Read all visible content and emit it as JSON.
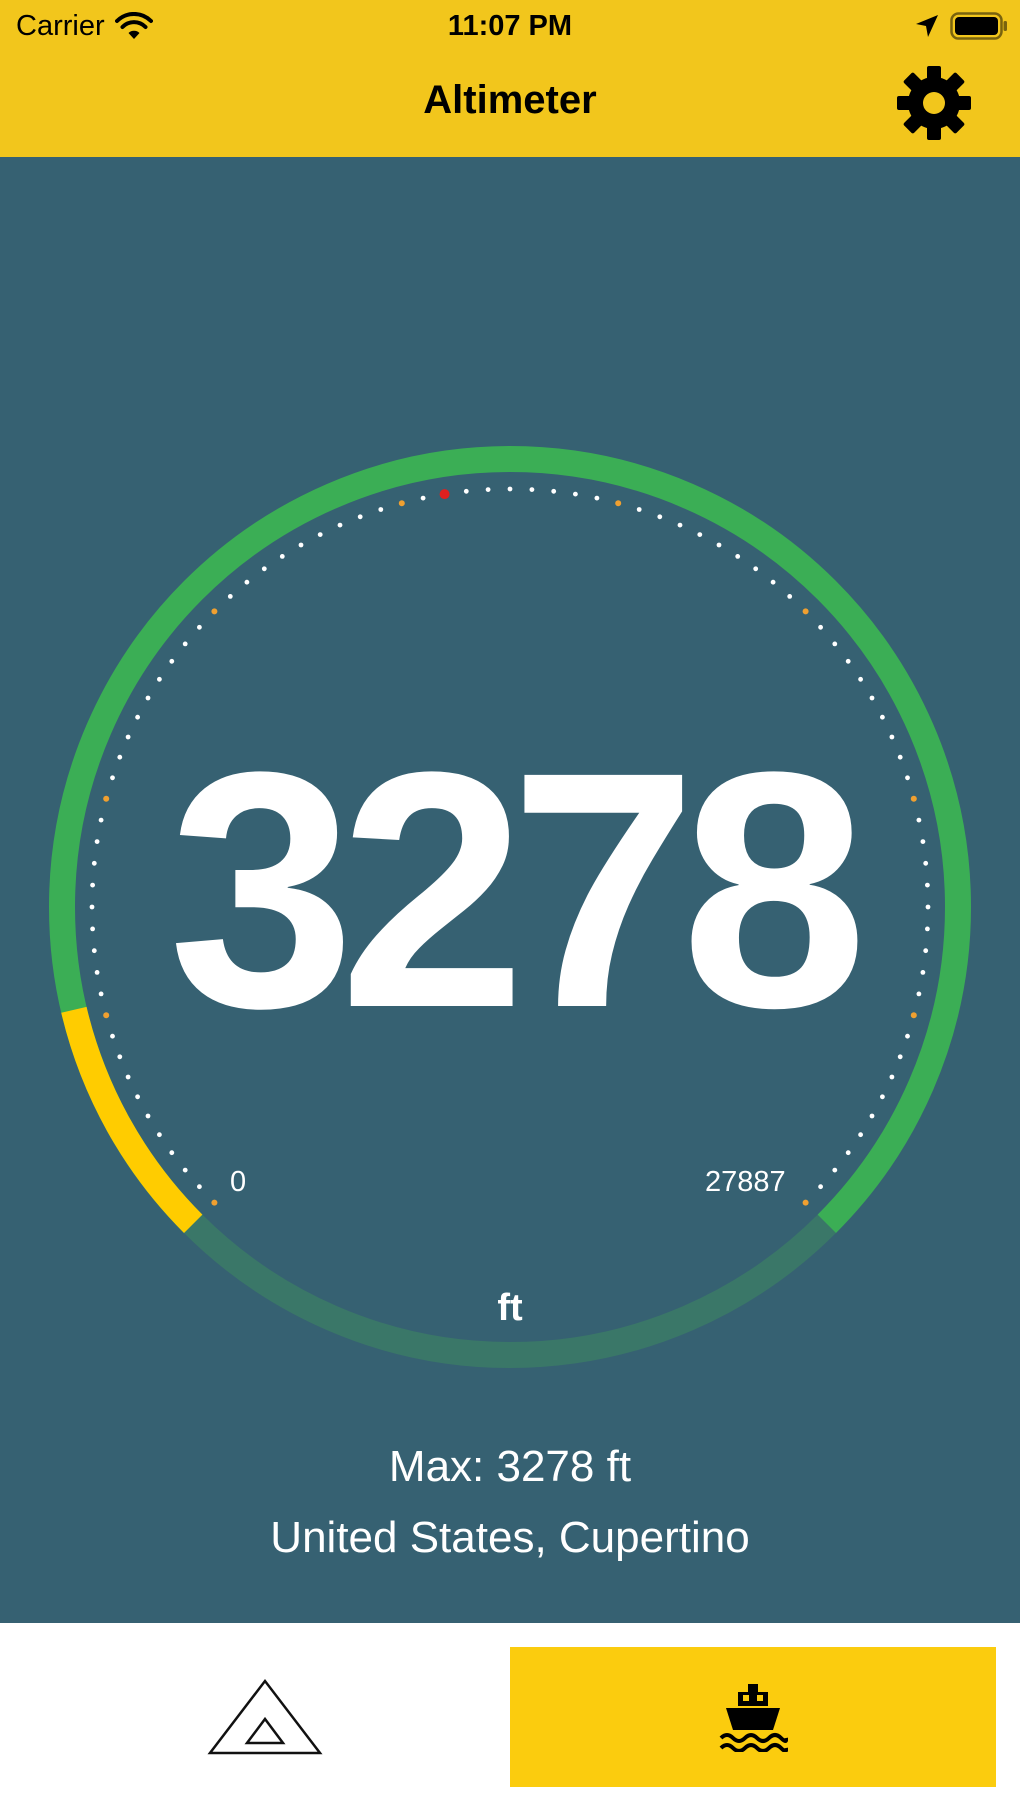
{
  "status_bar": {
    "carrier": "Carrier",
    "time": "11:07 PM",
    "icons": [
      "wifi-icon",
      "location-arrow-icon",
      "battery-icon"
    ]
  },
  "nav": {
    "title": "Altimeter",
    "settings_icon": "gear-icon"
  },
  "gauge": {
    "value": "3278",
    "min_label": "0",
    "max_label": "27887",
    "unit": "ft",
    "current": 3278,
    "min": 0,
    "max": 27887
  },
  "info": {
    "max_text": "Max: 3278 ft",
    "location": "United States, Cupertino"
  },
  "tabs": [
    {
      "icon": "mountain-icon",
      "selected": false
    },
    {
      "icon": "ship-icon",
      "selected": true
    }
  ],
  "colors": {
    "header": "#F2C61C",
    "background": "#366172",
    "ring_active": "#3BAE55",
    "ring_inactive": "#3A7768",
    "ring_level": "#FFCC00",
    "tick_major": "#F0A030",
    "tick_minor": "#FFFFFF",
    "indicator": "#E02020",
    "tab_selected": "#FBCC0E"
  }
}
